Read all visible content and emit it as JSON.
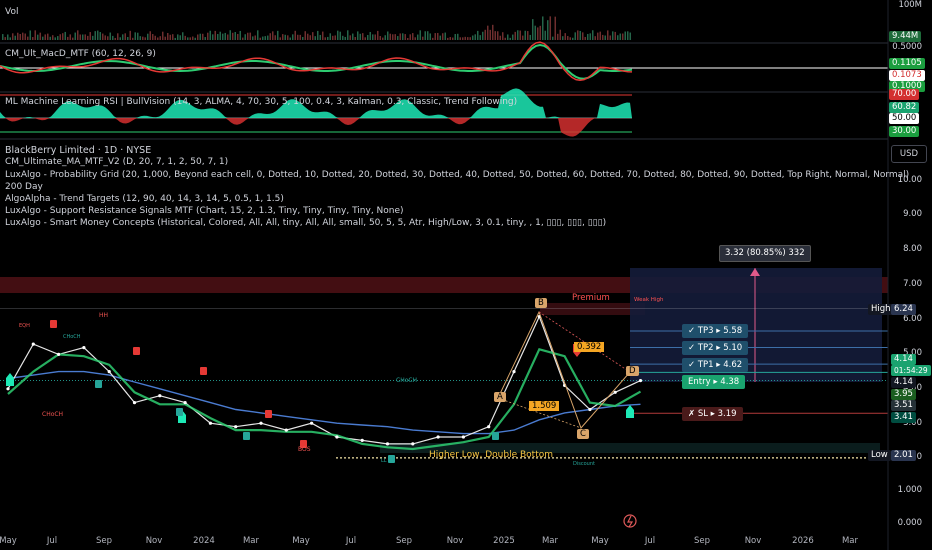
{
  "panes": {
    "vol_label": "Vol",
    "macd_label": "CM_Ult_MacD_MTF (60, 12, 26, 9)",
    "rsi_label": "ML Machine Learning RSI | BullVision (14, 3, ALMA, 4, 70, 30, 5, 100, 0.4, 3, Kalman, 0.3, Classic, Trend Following)"
  },
  "vol_axis": {
    "top": "100M",
    "last": "9.44M"
  },
  "macd_axis": {
    "top": "0.5000",
    "v1": "0.1105",
    "v2": "0.1073",
    "v3": "0.1000"
  },
  "rsi_axis": {
    "v70": "70.00",
    "v_last": "60.82",
    "v50": "50.00",
    "v30": "30.00"
  },
  "legend": {
    "symbol": "BlackBerry Limited · 1D · NYSE",
    "lines": [
      "CM_Ultimate_MA_MTF_V2 (D, 20, 7, 1, 2, 50, 7, 1)",
      "LuxAlgo - Probability Grid (20, 1,000, Beyond each cell, 0, Dotted, 10, Dotted, 20, Dotted, 30, Dotted, 40, Dotted, 50, Dotted, 60, Dotted, 70, Dotted, 80, Dotted, 90, Dotted, Top Right, Normal, Normal)",
      "200 Day",
      "AlgoAlpha - Trend Targets (12, 90, 40, 14, 3, 14, 5, 0.5, 1, 1.5)",
      "LuxAlgo - Support Resistance Signals MTF (Chart, 15, 2, 1.3, Tiny, Tiny, Tiny, Tiny, None)",
      "LuxAlgo - Smart Money Concepts (Historical, Colored, All, All, tiny, All, All, small, 50, 5, 5, Atr, High/Low, 3, 0.1, tiny, , 1, ▯▯▯, ▯▯▯, ▯▯▯)"
    ]
  },
  "currency_button": "USD",
  "price_axis_ticks": [
    "10.00",
    "9.00",
    "8.00",
    "7.00",
    "6.00",
    "5.00",
    "4.00",
    "3.00",
    "2.00",
    "1.000",
    "0.000"
  ],
  "price_tags": {
    "high_label": "High",
    "high_value": "6.24",
    "low_label": "Low",
    "low_value": "2.01",
    "last_price": "4.14",
    "countdown": "01:54:29",
    "p414b": "4.14",
    "p395": "3.95",
    "p351": "3.51",
    "p341": "3.41"
  },
  "x_axis_labels": [
    "May",
    "Jul",
    "Sep",
    "Nov",
    "2024",
    "Mar",
    "May",
    "Jul",
    "Sep",
    "Nov",
    "2025",
    "Mar",
    "May",
    "Jul",
    "Sep",
    "Nov",
    "2026",
    "Mar"
  ],
  "targets": {
    "range_label": "3.32 (80.85%) 332",
    "tp3": "✓ TP3 ▸ 5.58",
    "tp2": "✓ TP2 ▸ 5.10",
    "tp1": "✓ TP1 ▸ 4.62",
    "entry": "Entry ▸ 4.38",
    "sl": "✗ SL ▸ 3.19"
  },
  "annotations": {
    "premium": "Premium",
    "weak_high": "Weak High",
    "fib_a": "0.392",
    "fib_b": "1.509",
    "point_a": "A",
    "point_b": "B",
    "point_c": "C",
    "point_d": "D",
    "higher_low": "Higher Low, Double Bottom",
    "choch_1": "CHoCH",
    "choch_2": "CHoCH",
    "choch_3": "CHoCH",
    "bos": "BOS",
    "hh": "HH",
    "eqh": "EQH",
    "ll": "LL",
    "discount": "Discount"
  },
  "chart_data": {
    "type": "line",
    "title": "BlackBerry Limited · 1D · NYSE",
    "xlabel": "",
    "ylabel": "",
    "ylim": [
      0,
      10.5
    ],
    "grid": false,
    "series": [
      {
        "name": "",
        "x": [
          "2023-05",
          "2023-06",
          "2023-07",
          "2023-08",
          "2023-09",
          "2023-10",
          "2023-11",
          "2023-12",
          "2024-01",
          "2024-02",
          "2024-03",
          "2024-04",
          "2024-05",
          "2024-06",
          "2024-07",
          "2024-08",
          "2024-09",
          "2024-10",
          "2024-11",
          "2024-12",
          "2025-01",
          "2025-02",
          "2025-03",
          "2025-04",
          "2025-05",
          "2025-06"
        ],
        "values": [
          3.9,
          5.2,
          4.9,
          5.1,
          4.4,
          3.5,
          3.7,
          3.5,
          2.9,
          2.8,
          2.9,
          2.7,
          2.9,
          2.5,
          2.4,
          2.3,
          2.3,
          2.5,
          2.5,
          2.8,
          4.4,
          6.0,
          4.0,
          3.3,
          3.8,
          4.14
        ]
      }
    ],
    "levels": {
      "high": 6.24,
      "low": 2.01,
      "last": 4.14,
      "tp3": 5.58,
      "tp2": 5.1,
      "tp1": 4.62,
      "entry": 4.38,
      "sl": 3.19
    }
  }
}
